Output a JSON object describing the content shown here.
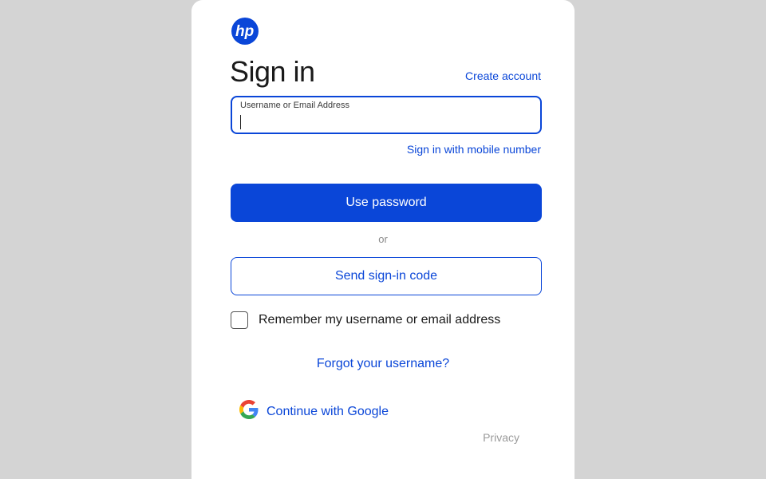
{
  "brand": {
    "logo_icon": "hp-logo-icon",
    "accent": "#0a46d8"
  },
  "header": {
    "title": "Sign in",
    "create_account": "Create account"
  },
  "username_field": {
    "label": "Username or Email Address",
    "value": "",
    "placeholder": ""
  },
  "links": {
    "mobile_sign_in": "Sign in with mobile number",
    "forgot_username": "Forgot your username?",
    "privacy": "Privacy"
  },
  "buttons": {
    "use_password": "Use password",
    "send_code": "Send sign-in code",
    "google": "Continue with Google"
  },
  "divider": {
    "or": "or"
  },
  "remember": {
    "label": "Remember my username or email address",
    "checked": false
  }
}
